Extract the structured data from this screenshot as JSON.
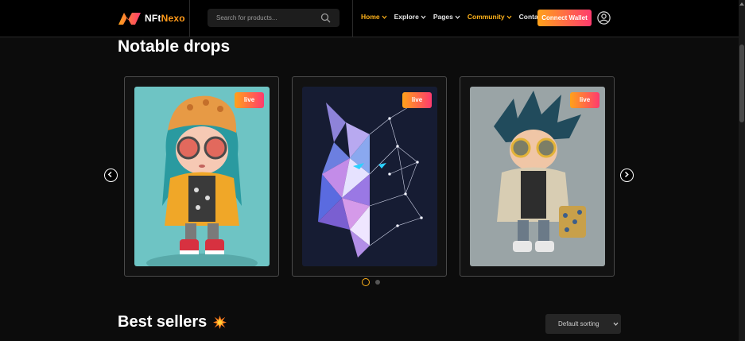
{
  "brand": {
    "name_prefix": "NFt",
    "name_suffix": "Nexo",
    "logo_icon": "nfnexo-logo-icon"
  },
  "search": {
    "placeholder": "Search for products..."
  },
  "nav": {
    "items": [
      {
        "label": "Home",
        "active": true,
        "dropdown": true
      },
      {
        "label": "Explore",
        "active": false,
        "dropdown": true
      },
      {
        "label": "Pages",
        "active": false,
        "dropdown": true
      },
      {
        "label": "Community",
        "active": true,
        "dropdown": true
      },
      {
        "label": "Contact",
        "active": false,
        "dropdown": false
      }
    ],
    "connect_label": "Connect Wallet"
  },
  "colors": {
    "accent": "#ffb21a",
    "gradient_start": "#ffa21a",
    "gradient_end": "#ff3a6e",
    "bg": "#0c0c0c"
  },
  "notable": {
    "title": "Notable drops",
    "cards": [
      {
        "badge": "live",
        "art": "girl-figure"
      },
      {
        "badge": "live",
        "art": "geometric-wolf"
      },
      {
        "badge": "live",
        "art": "boy-figure"
      }
    ],
    "pagination": {
      "current": 1,
      "total": 2
    }
  },
  "best_sellers": {
    "title": "Best sellers",
    "icon": "explosion-icon",
    "sort_value": "Default sorting"
  }
}
